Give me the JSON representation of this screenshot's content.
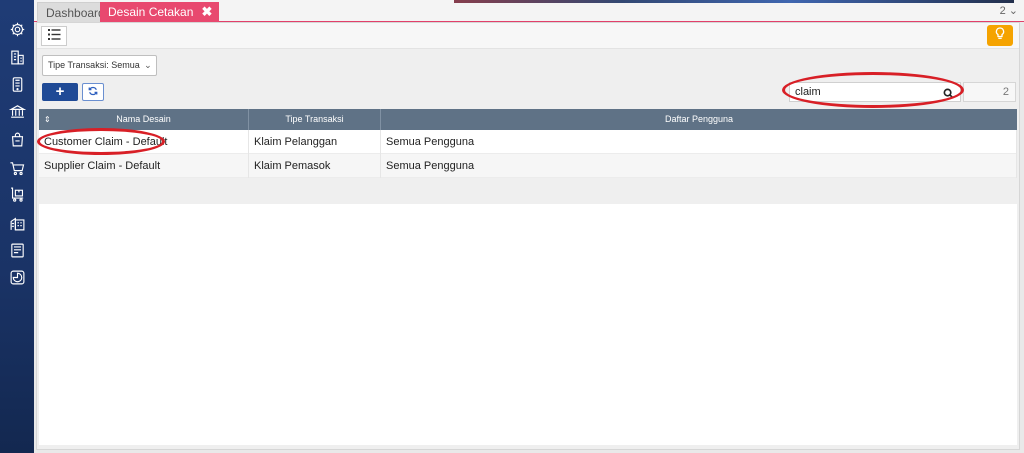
{
  "tabs": {
    "dashboard": "Dashboard",
    "desain_cetakan": "Desain Cetakan",
    "close": "✖",
    "count": "2 ⌄"
  },
  "sidebar": {
    "items": [
      {
        "name": "settings-gear-icon"
      },
      {
        "name": "company-building-icon"
      },
      {
        "name": "mobile-device-icon"
      },
      {
        "name": "bank-icon"
      },
      {
        "name": "shopping-bag-icon"
      },
      {
        "name": "shopping-cart-icon"
      },
      {
        "name": "delivery-cart-icon"
      },
      {
        "name": "warehouse-icon"
      },
      {
        "name": "report-document-icon"
      },
      {
        "name": "dashboard-chart-icon"
      }
    ]
  },
  "toolbar": {
    "list_icon": "list-icon",
    "bulb_icon": "lightbulb-icon"
  },
  "filter": {
    "label": "Tipe Transaksi: Semua",
    "chevron": "⌄"
  },
  "actions": {
    "add_label": "+",
    "refresh_icon": "refresh-icon"
  },
  "search": {
    "value": "claim",
    "count": "2"
  },
  "table": {
    "sort_icon": "⇕",
    "headers": [
      "Nama Desain",
      "Tipe Transaksi",
      "Daftar Pengguna"
    ],
    "rows": [
      [
        "Customer Claim - Default",
        "Klaim Pelanggan",
        "Semua Pengguna"
      ],
      [
        "Supplier Claim - Default",
        "Klaim Pemasok",
        "Semua Pengguna"
      ]
    ]
  },
  "colors": {
    "sidebar": "#1f3c76",
    "active_tab": "#e8496f",
    "header": "#5f7286",
    "primary_button": "#1f4a96",
    "highlight_oval": "#d81f26",
    "bulb_button": "#f5a300"
  }
}
